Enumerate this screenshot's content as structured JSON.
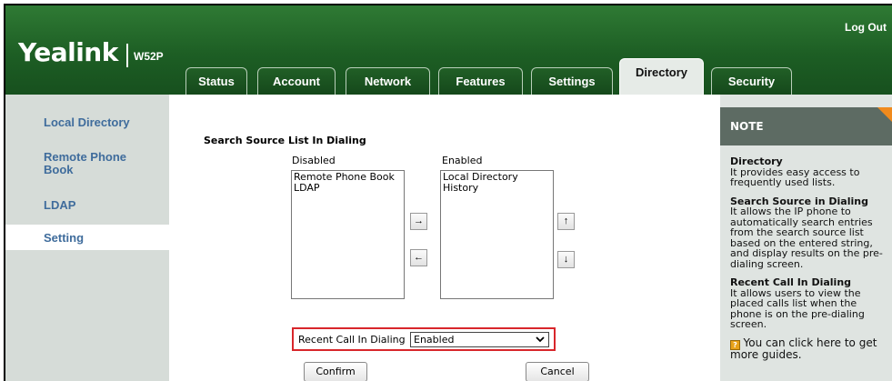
{
  "header": {
    "logout": "Log Out",
    "logo": "Yealink",
    "model": "W52P"
  },
  "tabs": [
    {
      "label": "Status",
      "active": false
    },
    {
      "label": "Account",
      "active": false
    },
    {
      "label": "Network",
      "active": false
    },
    {
      "label": "Features",
      "active": false
    },
    {
      "label": "Settings",
      "active": false
    },
    {
      "label": "Directory",
      "active": true
    },
    {
      "label": "Security",
      "active": false
    }
  ],
  "sidebar": {
    "items": [
      {
        "label": "Local Directory"
      },
      {
        "label": "Remote Phone Book"
      },
      {
        "label": "LDAP"
      },
      {
        "label": "Setting",
        "active": true
      }
    ]
  },
  "main": {
    "section_title": "Search Source List In Dialing",
    "disabled_label": "Disabled",
    "enabled_label": "Enabled",
    "disabled_items": [
      "Remote Phone Book",
      "LDAP"
    ],
    "enabled_items": [
      "Local Directory",
      "History"
    ],
    "move_right": "→",
    "move_left": "←",
    "move_up": "↑",
    "move_down": "↓",
    "recent_call_label": "Recent Call In Dialing",
    "recent_call_value": "Enabled",
    "confirm": "Confirm",
    "cancel": "Cancel"
  },
  "note": {
    "title": "NOTE",
    "sections": [
      {
        "heading": "Directory",
        "text": "It provides easy access to frequently used lists."
      },
      {
        "heading": "Search Source in Dialing",
        "text": "It allows the IP phone to automatically search entries from the search source list based on the entered string, and display results on the pre-dialing screen."
      },
      {
        "heading": "Recent Call In Dialing",
        "text": "It allows users to view the placed calls list when the phone is on the pre-dialing screen."
      }
    ],
    "guide": "You can click here to get more guides."
  },
  "colors": {
    "header_green": "#1d5e24",
    "nav_link": "#3f6c9c",
    "highlight_red": "#d8262b",
    "note_header": "#5d6b63",
    "note_corner": "#f08a1d"
  },
  "icons": [
    "guide-icon",
    "chevron-down-icon"
  ]
}
